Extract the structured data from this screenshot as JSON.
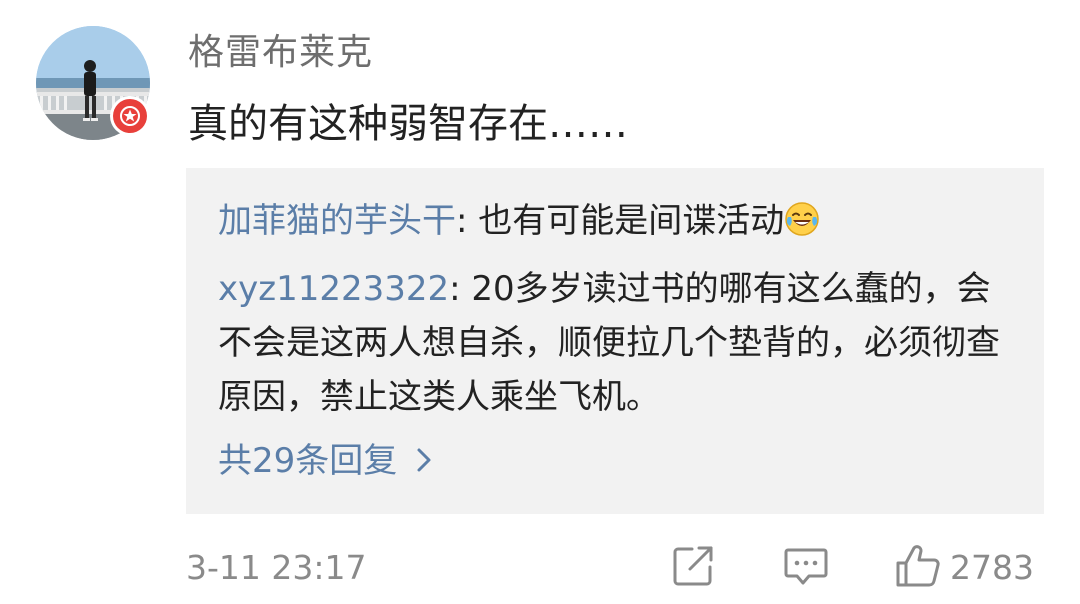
{
  "comment": {
    "username": "格雷布莱克",
    "text": "真的有这种弱智存在……",
    "avatar_icon": "user-avatar-photo",
    "badge_icon": "verified-star-badge",
    "badge_color": "#e8403b",
    "timestamp": "3-11 23:17",
    "like_count": "2783"
  },
  "replies": [
    {
      "user": "加菲猫的芋头干",
      "separator": ": ",
      "text": "也有可能是间谍活动",
      "emoji": "laughing-tears-emoji"
    },
    {
      "user": "xyz11223322",
      "separator": ": ",
      "text": "20多岁读过书的哪有这么蠢的，会不会是这两人想自杀，顺便拉几个垫背的，必须彻查原因，禁止这类人乘坐飞机。"
    }
  ],
  "more_replies": {
    "label": "共29条回复",
    "icon": "chevron-right-icon"
  },
  "actions": {
    "share_icon": "share-icon",
    "reply_icon": "comment-icon",
    "like_icon": "thumbs-up-icon"
  },
  "colors": {
    "link_blue": "#5b7ea8",
    "reply_bg": "#f2f2f2",
    "meta_gray": "#8a8a8a"
  }
}
